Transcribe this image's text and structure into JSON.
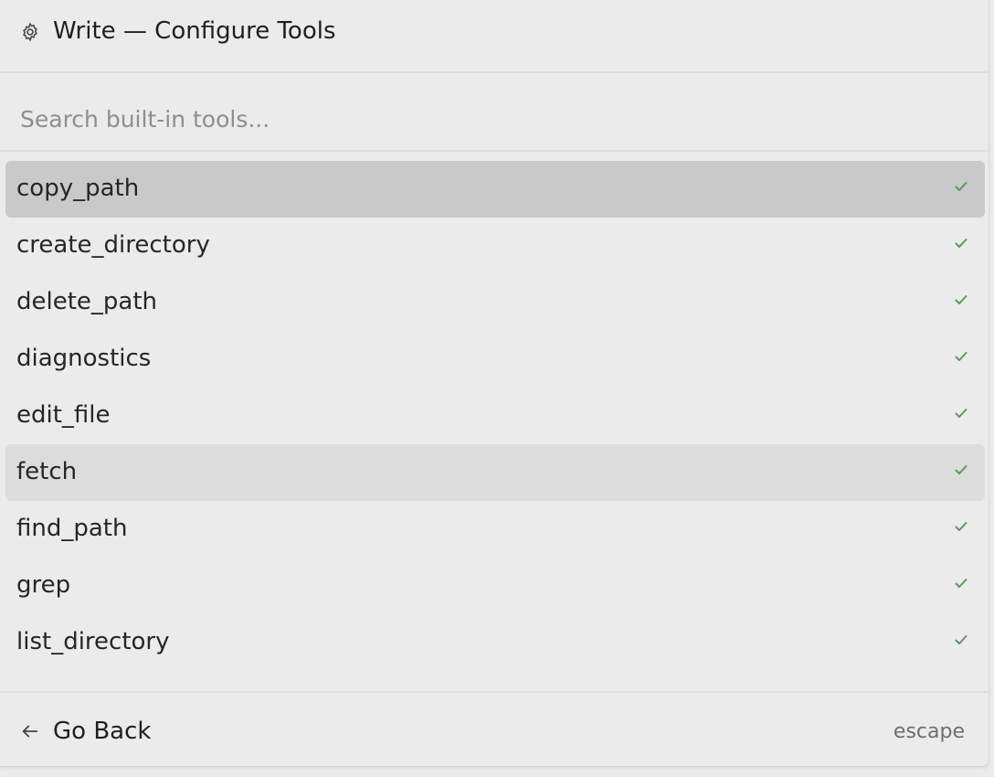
{
  "header": {
    "icon": "gear-icon",
    "title": "Write — Configure Tools"
  },
  "search": {
    "placeholder": "Search built-in tools...",
    "value": ""
  },
  "tools": [
    {
      "label": "copy_path",
      "enabled": true,
      "state": "selected"
    },
    {
      "label": "create_directory",
      "enabled": true,
      "state": ""
    },
    {
      "label": "delete_path",
      "enabled": true,
      "state": ""
    },
    {
      "label": "diagnostics",
      "enabled": true,
      "state": ""
    },
    {
      "label": "edit_file",
      "enabled": true,
      "state": ""
    },
    {
      "label": "fetch",
      "enabled": true,
      "state": "hover"
    },
    {
      "label": "find_path",
      "enabled": true,
      "state": ""
    },
    {
      "label": "grep",
      "enabled": true,
      "state": ""
    },
    {
      "label": "list_directory",
      "enabled": true,
      "state": ""
    }
  ],
  "footer": {
    "back_icon": "arrow-left-icon",
    "back_label": "Go Back",
    "shortcut": "escape"
  },
  "colors": {
    "check": "#5a9a5a",
    "selected_bg": "#c9c9c9",
    "hover_bg": "#dcdcdc",
    "panel_bg": "#ebebeb"
  }
}
